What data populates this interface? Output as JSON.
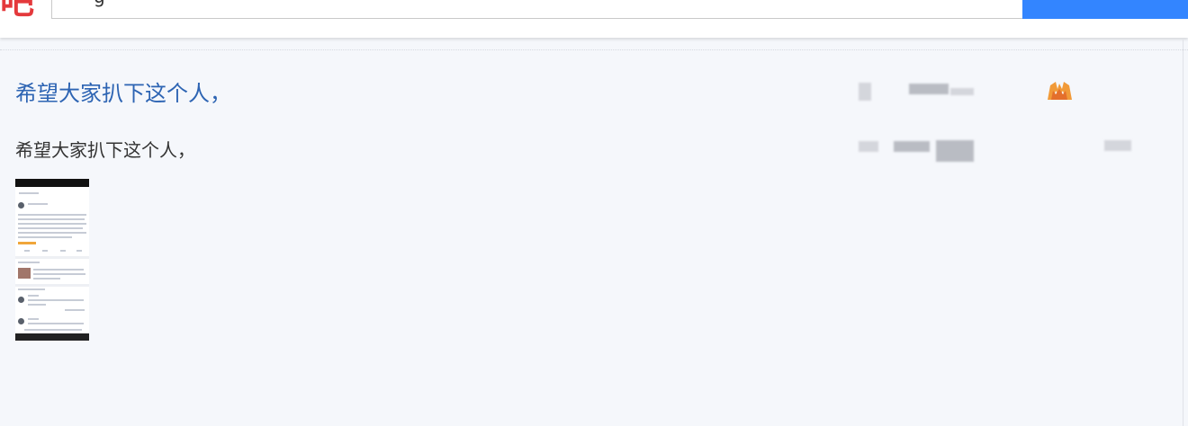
{
  "header": {
    "logo_text": "吧",
    "search_value": "g",
    "search_button_color": "#3385ff"
  },
  "thread": {
    "title": "希望大家扒下这个人，",
    "abstract": "希望大家扒下这个人，",
    "badge_icon": "fire-icon",
    "title_color": "#2d64b3"
  }
}
